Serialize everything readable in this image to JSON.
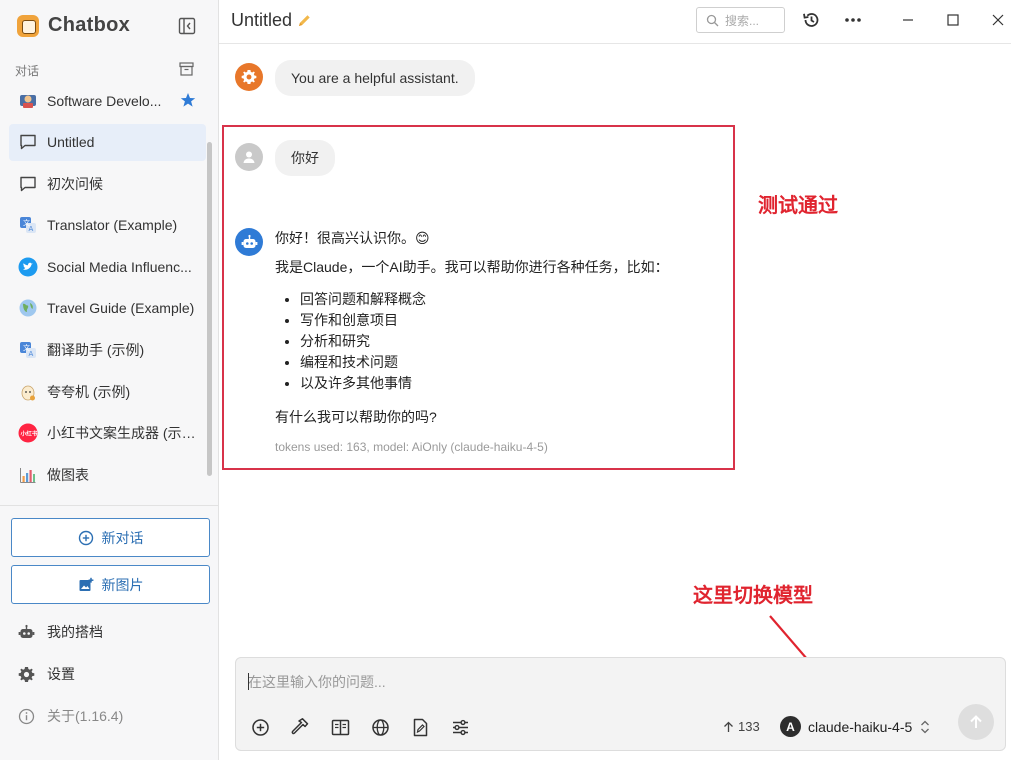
{
  "app": {
    "name": "Chatbox",
    "version_label": "关于(1.16.4)"
  },
  "sidebar": {
    "section_label": "对话",
    "conversations": [
      {
        "label": "Software Develo...",
        "icon": "developer-avatar",
        "starred": true
      },
      {
        "label": "Untitled",
        "icon": "chat-bubble-icon",
        "active": true
      },
      {
        "label": "初次问候",
        "icon": "chat-bubble-icon"
      },
      {
        "label": "Translator (Example)",
        "icon": "translator-avatar"
      },
      {
        "label": "Social Media Influenc...",
        "icon": "twitter-avatar"
      },
      {
        "label": "Travel Guide (Example)",
        "icon": "globe-avatar"
      },
      {
        "label": "翻译助手 (示例)",
        "icon": "translator-avatar"
      },
      {
        "label": "夸夸机 (示例)",
        "icon": "cheer-avatar"
      },
      {
        "label": "小红书文案生成器 (示例)",
        "icon": "xiaohongshu-avatar"
      },
      {
        "label": "做图表",
        "icon": "chart-avatar"
      }
    ],
    "new_chat_label": "新对话",
    "new_image_label": "新图片",
    "my_partners_label": "我的搭档",
    "settings_label": "设置"
  },
  "header": {
    "title": "Untitled",
    "search_placeholder": "搜索..."
  },
  "messages": {
    "system": "You are a helpful assistant.",
    "user": "你好",
    "assistant": {
      "greeting": "你好！很高兴认识你。😊",
      "intro": "我是Claude，一个AI助手。我可以帮助你进行各种任务，比如：",
      "bullets": [
        "回答问题和解释概念",
        "写作和创意项目",
        "分析和研究",
        "编程和技术问题",
        "以及许多其他事情"
      ],
      "closing": "有什么我可以帮助你的吗?",
      "meta": "tokens used: 163, model: AiOnly (claude-haiku-4-5)"
    }
  },
  "annotations": {
    "test_passed": "测试通过",
    "switch_model": "这里切换模型"
  },
  "composer": {
    "placeholder": "在这里输入你的问题...",
    "token_count": "133",
    "model_badge": "A",
    "model_name": "claude-haiku-4-5"
  },
  "colors": {
    "accent": "#2c6fb3",
    "active_bg": "#e7eef9",
    "highlight": "#d8334a",
    "annotation": "#e0242f",
    "system_avatar": "#e8772a",
    "assistant_avatar": "#2f7bd6"
  }
}
